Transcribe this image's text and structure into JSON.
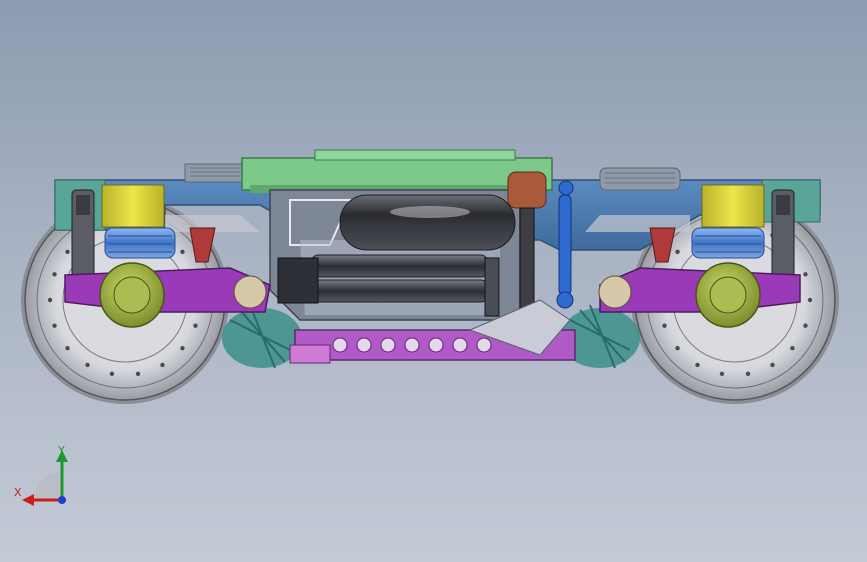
{
  "viewport": {
    "background_top": "#8d9bb0",
    "background_bottom": "#c4cad6"
  },
  "model": {
    "subject": "bogie-assembly",
    "colors": {
      "wheel": "#dcdde2",
      "frame_blue": "#4f7fb5",
      "frame_teal": "#5aa59a",
      "green_plate": "#7dc98a",
      "axle_box": "#9bb04a",
      "yellow_block": "#d8d23c",
      "purple_arm": "#9a3ab8",
      "air_tank": "#3a3d44",
      "spring_blue": "#5b8fd8",
      "damper_blue": "#2e6bd1",
      "magenta_beam": "#b05ac8",
      "brown_valve": "#a85a3a"
    }
  },
  "triad": {
    "x_label": "X",
    "y_label": "Y",
    "x_color": "#c81e1e",
    "y_color": "#1c9a2e",
    "z_color": "#1f3fd0"
  }
}
